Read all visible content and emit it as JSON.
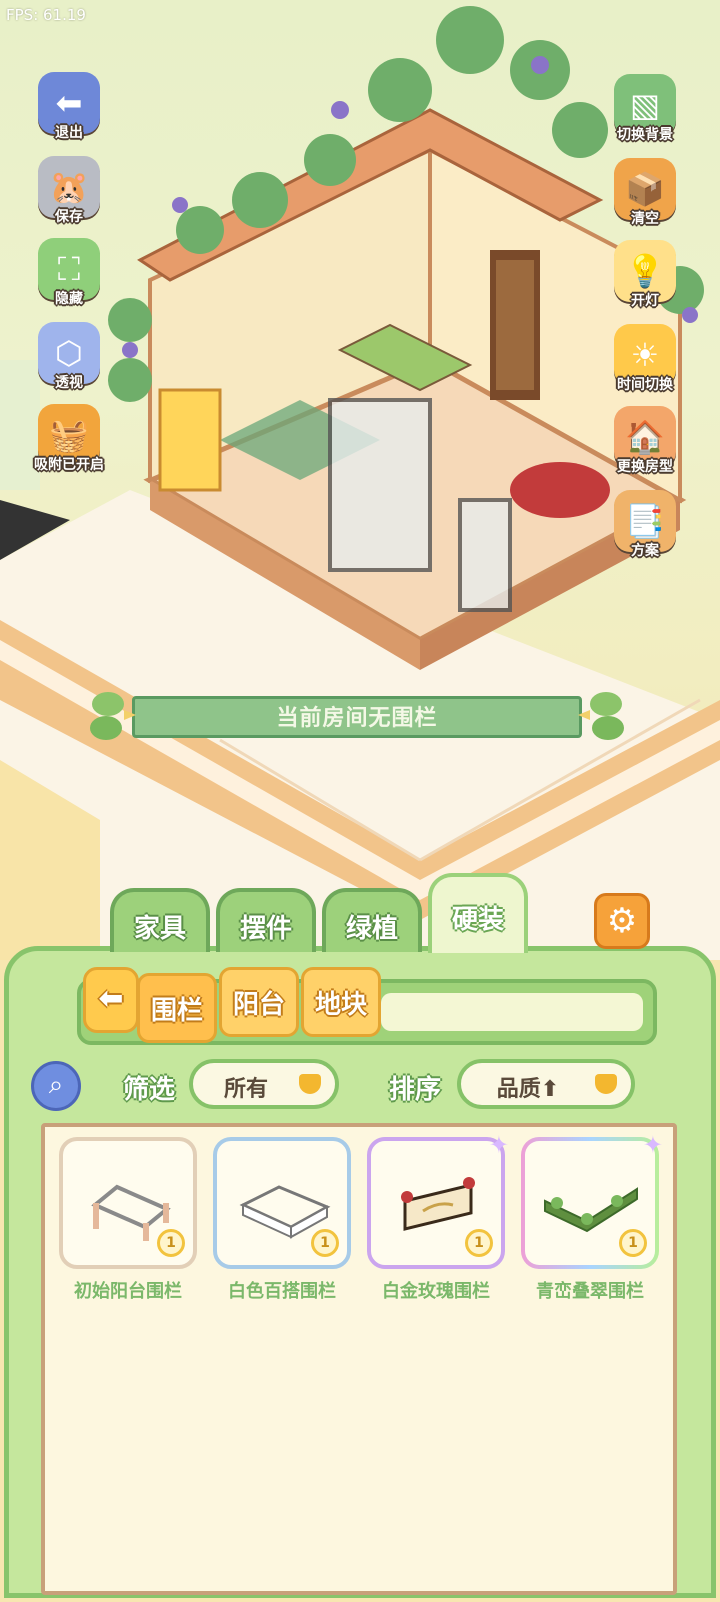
{
  "fps": "FPS: 61.19",
  "left_buttons": [
    {
      "label": "退出",
      "icon": "exit-arrow-icon"
    },
    {
      "label": "保存",
      "icon": "save-hamster-icon"
    },
    {
      "label": "隐藏",
      "icon": "hide-frame-icon"
    },
    {
      "label": "透视",
      "icon": "perspective-cube-icon"
    },
    {
      "label": "吸附已开启",
      "icon": "snap-basket-icon"
    }
  ],
  "right_buttons": [
    {
      "label": "切换背景",
      "icon": "background-switch-icon"
    },
    {
      "label": "清空",
      "icon": "clear-box-icon"
    },
    {
      "label": "开灯",
      "icon": "light-bulb-icon"
    },
    {
      "label": "时间切换",
      "icon": "sun-moon-icon"
    },
    {
      "label": "更换房型",
      "icon": "house-icon"
    },
    {
      "label": "方案",
      "icon": "plans-icon"
    }
  ],
  "banner": "当前房间无围栏",
  "tabs": [
    {
      "label": "家具",
      "active": false
    },
    {
      "label": "摆件",
      "active": false
    },
    {
      "label": "绿植",
      "active": false
    },
    {
      "label": "硬装",
      "active": true
    }
  ],
  "subtabs": [
    {
      "label": "围栏",
      "active": true
    },
    {
      "label": "阳台",
      "active": false
    },
    {
      "label": "地块",
      "active": false
    }
  ],
  "filter": {
    "label": "筛选",
    "value": "所有"
  },
  "sort": {
    "label": "排序",
    "value": "品质⬆"
  },
  "items": [
    {
      "name": "初始阳台围栏",
      "count": "1",
      "rarity": "common"
    },
    {
      "name": "白色百搭围栏",
      "count": "1",
      "rarity": "rare"
    },
    {
      "name": "白金玫瑰围栏",
      "count": "1",
      "rarity": "epic"
    },
    {
      "name": "青峦叠翠围栏",
      "count": "1",
      "rarity": "legendary"
    }
  ],
  "colors": {
    "panel_green": "#c5e79d",
    "accent_orange": "#f6a23a",
    "item_name_green": "#7bb86a"
  }
}
